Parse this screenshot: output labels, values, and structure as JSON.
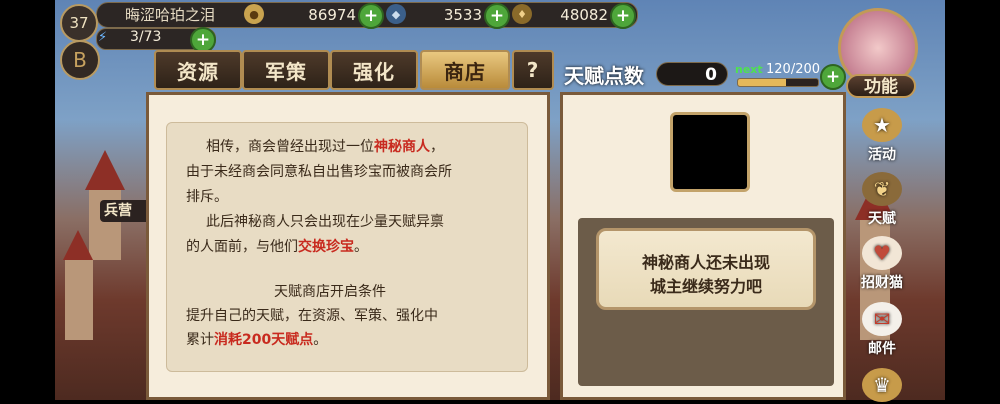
{
  "player": {
    "level": "37",
    "name": "晦涩哈珀之泪",
    "stamina": "3/73",
    "emblem": "B"
  },
  "resources": {
    "gold": "86974",
    "crystal": "3533",
    "food": "48082"
  },
  "tabs": [
    {
      "label": "资源"
    },
    {
      "label": "军策"
    },
    {
      "label": "强化"
    },
    {
      "label": "商店"
    },
    {
      "label": "?"
    }
  ],
  "talent": {
    "label": "天赋点数",
    "points": "0",
    "next_label": "next",
    "next_value": "120/200",
    "progress": 0.6
  },
  "left_panel": {
    "line1_pre": "相传，商会曾经出现过一位",
    "line1_red": "神秘商人",
    "line1_post": "，",
    "line2": "由于未经商会同意私自出售珍宝而被商会所",
    "line3": "排斥。",
    "line4": "此后神秘商人只会出现在少量天赋异禀",
    "line5_pre": "的人面前，与他们",
    "line5_red": "交换珍宝",
    "line5_post": "。",
    "cond_title": "天赋商店开启条件",
    "cond_line1": "提升自己的天赋，在资源、军策、强化中",
    "cond_line2_pre": "累计",
    "cond_line2_red": "消耗200天赋点",
    "cond_line2_post": "。"
  },
  "right_panel": {
    "message_line1": "神秘商人还未出现",
    "message_line2": "城主继续努力吧"
  },
  "side_menu": {
    "function": "功能",
    "activity": "活动",
    "talent": "天赋",
    "lucky_cat": "招财猫",
    "mail": "邮件"
  },
  "background": {
    "building_label": "兵营"
  },
  "colors": {
    "accent_red": "#c82a1f",
    "plus_green": "#4ea63a",
    "active_tab": "#e9c880"
  }
}
